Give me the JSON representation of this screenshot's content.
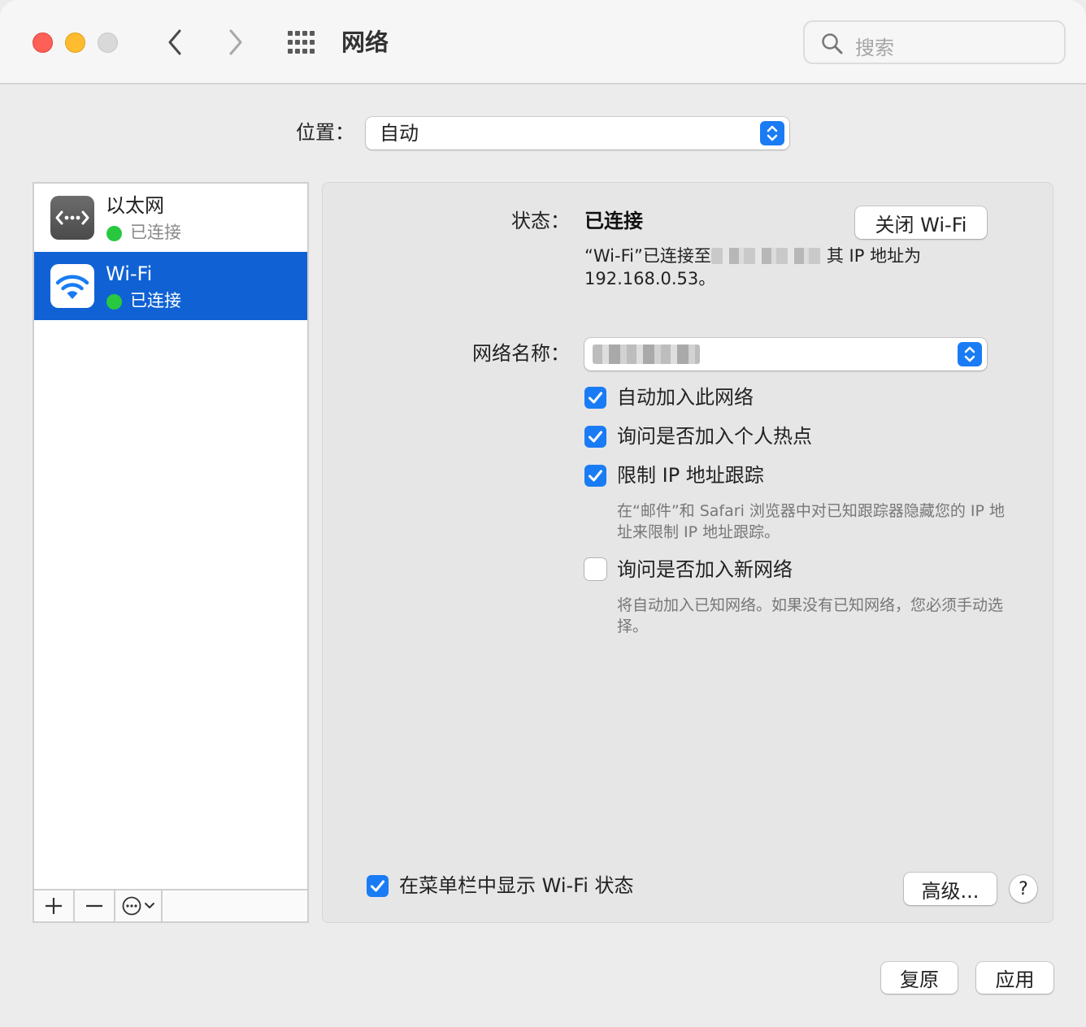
{
  "window": {
    "title": "网络"
  },
  "search": {
    "placeholder": "搜索"
  },
  "location": {
    "label": "位置：",
    "value": "自动"
  },
  "services": [
    {
      "name": "以太网",
      "status": "已连接",
      "icon": "ethernet-icon",
      "status_color": "#28c840"
    },
    {
      "name": "Wi-Fi",
      "status": "已连接",
      "icon": "wifi-icon",
      "status_color": "#28c840",
      "selected": true
    }
  ],
  "sidebar_toolbar": {
    "add": "+",
    "remove": "—"
  },
  "detail": {
    "status_label": "状态：",
    "status_value": "已连接",
    "toggle_button": "关闭 Wi-Fi",
    "status_desc_before": "“Wi-Fi”已连接至",
    "status_desc_after": "其 IP 地址为 192.168.0.53。",
    "network_name_label": "网络名称：",
    "options": [
      {
        "label": "自动加入此网络",
        "checked": true
      },
      {
        "label": "询问是否加入个人热点",
        "checked": true
      },
      {
        "label": "限制 IP 地址跟踪",
        "checked": true,
        "help": "在“邮件”和 Safari 浏览器中对已知跟踪器隐藏您的 IP 地址来限制 IP 地址跟踪。"
      },
      {
        "label": "询问是否加入新网络",
        "checked": false,
        "help": "将自动加入已知网络。如果没有已知网络，您必须手动选择。"
      }
    ],
    "menubar_option": {
      "label": "在菜单栏中显示 Wi-Fi 状态",
      "checked": true
    },
    "advanced_button": "高级...",
    "help_button": "?"
  },
  "footer": {
    "revert": "复原",
    "apply": "应用"
  },
  "colors": {
    "accent": "#1a7cf5",
    "selection": "#1062d4",
    "connected": "#28c840"
  }
}
